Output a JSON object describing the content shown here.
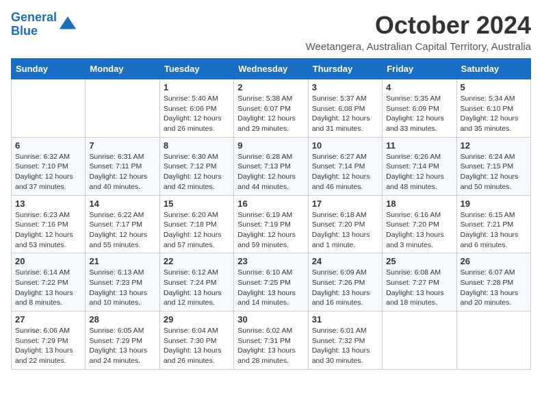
{
  "logo": {
    "line1": "General",
    "line2": "Blue"
  },
  "title": "October 2024",
  "subtitle": "Weetangera, Australian Capital Territory, Australia",
  "days_of_week": [
    "Sunday",
    "Monday",
    "Tuesday",
    "Wednesday",
    "Thursday",
    "Friday",
    "Saturday"
  ],
  "weeks": [
    [
      {
        "day": "",
        "info": ""
      },
      {
        "day": "",
        "info": ""
      },
      {
        "day": "1",
        "info": "Sunrise: 5:40 AM\nSunset: 6:06 PM\nDaylight: 12 hours\nand 26 minutes."
      },
      {
        "day": "2",
        "info": "Sunrise: 5:38 AM\nSunset: 6:07 PM\nDaylight: 12 hours\nand 29 minutes."
      },
      {
        "day": "3",
        "info": "Sunrise: 5:37 AM\nSunset: 6:08 PM\nDaylight: 12 hours\nand 31 minutes."
      },
      {
        "day": "4",
        "info": "Sunrise: 5:35 AM\nSunset: 6:09 PM\nDaylight: 12 hours\nand 33 minutes."
      },
      {
        "day": "5",
        "info": "Sunrise: 5:34 AM\nSunset: 6:10 PM\nDaylight: 12 hours\nand 35 minutes."
      }
    ],
    [
      {
        "day": "6",
        "info": "Sunrise: 6:32 AM\nSunset: 7:10 PM\nDaylight: 12 hours\nand 37 minutes."
      },
      {
        "day": "7",
        "info": "Sunrise: 6:31 AM\nSunset: 7:11 PM\nDaylight: 12 hours\nand 40 minutes."
      },
      {
        "day": "8",
        "info": "Sunrise: 6:30 AM\nSunset: 7:12 PM\nDaylight: 12 hours\nand 42 minutes."
      },
      {
        "day": "9",
        "info": "Sunrise: 6:28 AM\nSunset: 7:13 PM\nDaylight: 12 hours\nand 44 minutes."
      },
      {
        "day": "10",
        "info": "Sunrise: 6:27 AM\nSunset: 7:14 PM\nDaylight: 12 hours\nand 46 minutes."
      },
      {
        "day": "11",
        "info": "Sunrise: 6:26 AM\nSunset: 7:14 PM\nDaylight: 12 hours\nand 48 minutes."
      },
      {
        "day": "12",
        "info": "Sunrise: 6:24 AM\nSunset: 7:15 PM\nDaylight: 12 hours\nand 50 minutes."
      }
    ],
    [
      {
        "day": "13",
        "info": "Sunrise: 6:23 AM\nSunset: 7:16 PM\nDaylight: 12 hours\nand 53 minutes."
      },
      {
        "day": "14",
        "info": "Sunrise: 6:22 AM\nSunset: 7:17 PM\nDaylight: 12 hours\nand 55 minutes."
      },
      {
        "day": "15",
        "info": "Sunrise: 6:20 AM\nSunset: 7:18 PM\nDaylight: 12 hours\nand 57 minutes."
      },
      {
        "day": "16",
        "info": "Sunrise: 6:19 AM\nSunset: 7:19 PM\nDaylight: 12 hours\nand 59 minutes."
      },
      {
        "day": "17",
        "info": "Sunrise: 6:18 AM\nSunset: 7:20 PM\nDaylight: 13 hours\nand 1 minute."
      },
      {
        "day": "18",
        "info": "Sunrise: 6:16 AM\nSunset: 7:20 PM\nDaylight: 13 hours\nand 3 minutes."
      },
      {
        "day": "19",
        "info": "Sunrise: 6:15 AM\nSunset: 7:21 PM\nDaylight: 13 hours\nand 6 minutes."
      }
    ],
    [
      {
        "day": "20",
        "info": "Sunrise: 6:14 AM\nSunset: 7:22 PM\nDaylight: 13 hours\nand 8 minutes."
      },
      {
        "day": "21",
        "info": "Sunrise: 6:13 AM\nSunset: 7:23 PM\nDaylight: 13 hours\nand 10 minutes."
      },
      {
        "day": "22",
        "info": "Sunrise: 6:12 AM\nSunset: 7:24 PM\nDaylight: 13 hours\nand 12 minutes."
      },
      {
        "day": "23",
        "info": "Sunrise: 6:10 AM\nSunset: 7:25 PM\nDaylight: 13 hours\nand 14 minutes."
      },
      {
        "day": "24",
        "info": "Sunrise: 6:09 AM\nSunset: 7:26 PM\nDaylight: 13 hours\nand 16 minutes."
      },
      {
        "day": "25",
        "info": "Sunrise: 6:08 AM\nSunset: 7:27 PM\nDaylight: 13 hours\nand 18 minutes."
      },
      {
        "day": "26",
        "info": "Sunrise: 6:07 AM\nSunset: 7:28 PM\nDaylight: 13 hours\nand 20 minutes."
      }
    ],
    [
      {
        "day": "27",
        "info": "Sunrise: 6:06 AM\nSunset: 7:29 PM\nDaylight: 13 hours\nand 22 minutes."
      },
      {
        "day": "28",
        "info": "Sunrise: 6:05 AM\nSunset: 7:29 PM\nDaylight: 13 hours\nand 24 minutes."
      },
      {
        "day": "29",
        "info": "Sunrise: 6:04 AM\nSunset: 7:30 PM\nDaylight: 13 hours\nand 26 minutes."
      },
      {
        "day": "30",
        "info": "Sunrise: 6:02 AM\nSunset: 7:31 PM\nDaylight: 13 hours\nand 28 minutes."
      },
      {
        "day": "31",
        "info": "Sunrise: 6:01 AM\nSunset: 7:32 PM\nDaylight: 13 hours\nand 30 minutes."
      },
      {
        "day": "",
        "info": ""
      },
      {
        "day": "",
        "info": ""
      }
    ]
  ]
}
